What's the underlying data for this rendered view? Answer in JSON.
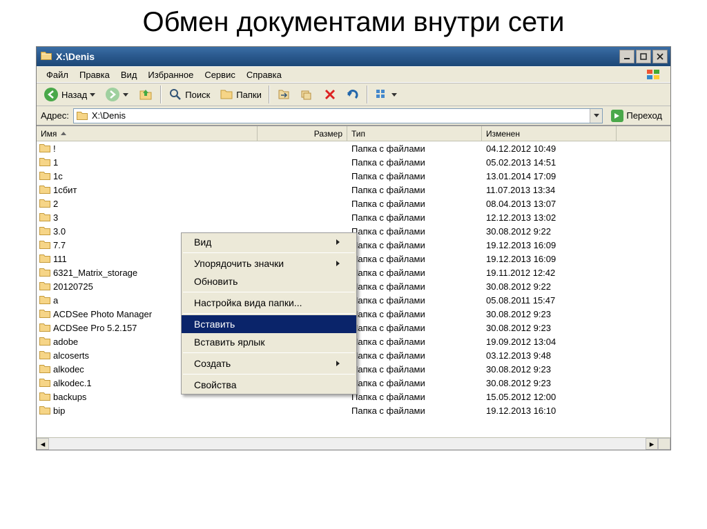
{
  "slide_title": "Обмен документами внутри сети",
  "titlebar": {
    "path": "X:\\Denis"
  },
  "menu": {
    "file": "Файл",
    "edit": "Правка",
    "view": "Вид",
    "favorites": "Избранное",
    "tools": "Сервис",
    "help": "Справка"
  },
  "toolbar": {
    "back": "Назад",
    "search": "Поиск",
    "folders": "Папки"
  },
  "address": {
    "label": "Адрес:",
    "value": "X:\\Denis",
    "go": "Переход"
  },
  "columns": {
    "name": "Имя",
    "size": "Размер",
    "type": "Тип",
    "modified": "Изменен"
  },
  "folder_type": "Папка с файлами",
  "items": [
    {
      "name": "!",
      "type": "Папка с файлами",
      "modified": "04.12.2012 10:49"
    },
    {
      "name": "1",
      "type": "Папка с файлами",
      "modified": "05.02.2013 14:51"
    },
    {
      "name": "1c",
      "type": "Папка с файлами",
      "modified": "13.01.2014 17:09"
    },
    {
      "name": "1сбит",
      "type": "Папка с файлами",
      "modified": "11.07.2013 13:34"
    },
    {
      "name": "2",
      "type": "Папка с файлами",
      "modified": "08.04.2013 13:07"
    },
    {
      "name": "3",
      "type": "Папка с файлами",
      "modified": "12.12.2013 13:02"
    },
    {
      "name": "3.0",
      "type": "Папка с файлами",
      "modified": "30.08.2012 9:22"
    },
    {
      "name": "7.7",
      "type": "Папка с файлами",
      "modified": "19.12.2013 16:09"
    },
    {
      "name": "111",
      "type": "Папка с файлами",
      "modified": "19.12.2013 16:09"
    },
    {
      "name": "6321_Matrix_storage",
      "type": "Папка с файлами",
      "modified": "19.11.2012 12:42"
    },
    {
      "name": "20120725",
      "type": "Папка с файлами",
      "modified": "30.08.2012 9:22"
    },
    {
      "name": "a",
      "type": "Папка с файлами",
      "modified": "05.08.2011 15:47"
    },
    {
      "name": "ACDSee Photo Manager",
      "type": "Папка с файлами",
      "modified": "30.08.2012 9:23"
    },
    {
      "name": "ACDSee Pro 5.2.157",
      "type": "Папка с файлами",
      "modified": "30.08.2012 9:23"
    },
    {
      "name": "adobe",
      "type": "Папка с файлами",
      "modified": "19.09.2012 13:04"
    },
    {
      "name": "alcoserts",
      "type": "Папка с файлами",
      "modified": "03.12.2013 9:48"
    },
    {
      "name": "alkodec",
      "type": "Папка с файлами",
      "modified": "30.08.2012 9:23"
    },
    {
      "name": "alkodec.1",
      "type": "Папка с файлами",
      "modified": "30.08.2012 9:23"
    },
    {
      "name": "backups",
      "type": "Папка с файлами",
      "modified": "15.05.2012 12:00"
    },
    {
      "name": "bip",
      "type": "Папка с файлами",
      "modified": "19.12.2013 16:10"
    }
  ],
  "context_menu": {
    "view": "Вид",
    "arrange": "Упорядочить значки",
    "refresh": "Обновить",
    "customize": "Настройка вида папки...",
    "paste": "Вставить",
    "paste_shortcut": "Вставить ярлык",
    "new": "Создать",
    "properties": "Свойства"
  }
}
